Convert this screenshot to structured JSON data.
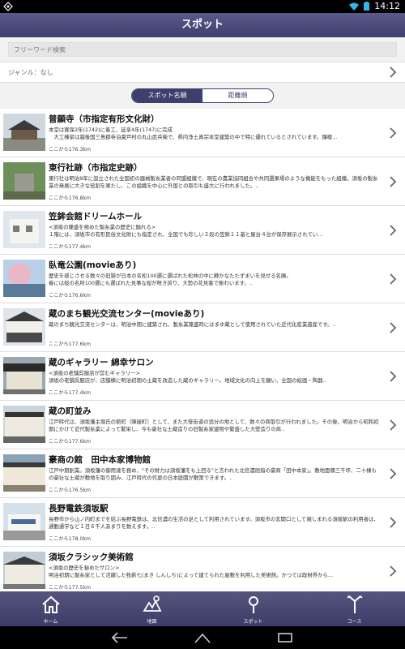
{
  "status": {
    "time": "14:12"
  },
  "header": {
    "title": "スポット"
  },
  "search": {
    "placeholder": "フリーワード検索"
  },
  "genre": {
    "label": "ジャンル：なし"
  },
  "sort": {
    "by_name": "スポット名順",
    "by_distance": "距離順"
  },
  "spots": [
    {
      "title": "普願寺（市指定有形文化財）",
      "desc": "本堂は寛保2年(1742)に着工、延享4年(1747)に完成\n　大工棟梁は越後国三島郡寺泊夏戸村の丸山武兵衛で、県内浄土真宗本堂建築の中で特に優れているとされています。鐘楼...",
      "dist": "ここから176.3km"
    },
    {
      "title": "東行社跡（市指定史跡）",
      "desc": "東行社は明治9年に設立された全国初の器械製糸業者の同盟組織で、現在の農業協同組合や共同選果場のような機能をもった組織。須坂の製糸業の発展に大きな役割を果たし、この組織を中心に外国との取引も盛大に行われました。..",
      "dist": "ここから176.8km"
    },
    {
      "title": "笠鉾会館ドリームホール",
      "desc": "<須坂の隆盛を極めた製糸業の歴史に触れる>\n１階には、須坂市の有形民俗文化財にも指定され、全国でも珍しい２段の笠鉾１１基と屋台４台が保存展示されてい...",
      "dist": "ここから177.4km"
    },
    {
      "title": "臥竜公園(movieあり)",
      "desc": "歴史を感じさせる数々の旧跡が日本の名松100選に選ばれた松林の中に静かなたたずまいを見せる名勝。\n春には桜の名所100選にも選ばれた見事な桜が咲き誇り、大勢の花見客で賑わいます。..",
      "dist": "ここから176.6km"
    },
    {
      "title": "蔵のまち観光交流センター(movieあり)",
      "desc": "蔵のまち観光交流センターは、明治中期に建築され、製糸業隆盛時にはまゆ蔵として使用されていた近代化産業遺産です。..",
      "dist": "ここから177.6km"
    },
    {
      "title": "蔵のギャラリー 綿幸サロン",
      "desc": "<須坂の老舗呉服店が営むギャラリー>\n須坂の老舗呉服店が、店舗横に明治初期の土蔵を改造した蔵のギャラリー。地域文化の向上を願い、全国の絵画・陶器..",
      "dist": "ここから177.4km"
    },
    {
      "title": "蔵の町並み",
      "desc": "江戸時代は、須坂藩主堀氏の館町（陣屋町）として、また大笹街道の追分の地として、数々の商取引が行われました。その後、明治から昭和初期にかけて近代製糸業によって繁栄し、今も豪壮な土蔵造りの旧製糸家建物や繁盛した大壁造りの商..",
      "dist": "ここから177.6km"
    },
    {
      "title": "豪商の館　田中本家博物館",
      "desc": "江戸中期創業。須坂藩の御用達を務め、\"その財力は須坂藩をも上回る\"と言われた北信濃屈指の豪商「田中本家」。敷地面積三千坪、二十棟もの豪壮な土蔵が敷地を取り囲み、江戸時代の作庭の日本庭園が敷策できます。..",
      "dist": "ここから176.5km"
    },
    {
      "title": "長野電鉄須坂駅",
      "desc": "長野市から山ノ内町までを結ぶ長野電鉄は、北信濃の生活の足として利用されています。須坂市の玄関口として親しまれる須坂駅の利用者は、通勤通学など１日６千人あまりを数えます。..",
      "dist": "ここから178.0km"
    },
    {
      "title": "須坂クラシック美術館",
      "desc": "<須坂の歴史を秘めたサロン>\n明治初期に製糸家として活躍した牧新七(まき しんしち)によって建てられた屋敷を利用した美術館。かつては政財界から...",
      "dist": "ここから177.5km"
    }
  ],
  "tabs": [
    {
      "label": "ホーム",
      "icon": "home-icon"
    },
    {
      "label": "地図",
      "icon": "map-icon"
    },
    {
      "label": "スポット",
      "icon": "pin-icon"
    },
    {
      "label": "コース",
      "icon": "course-icon"
    }
  ]
}
